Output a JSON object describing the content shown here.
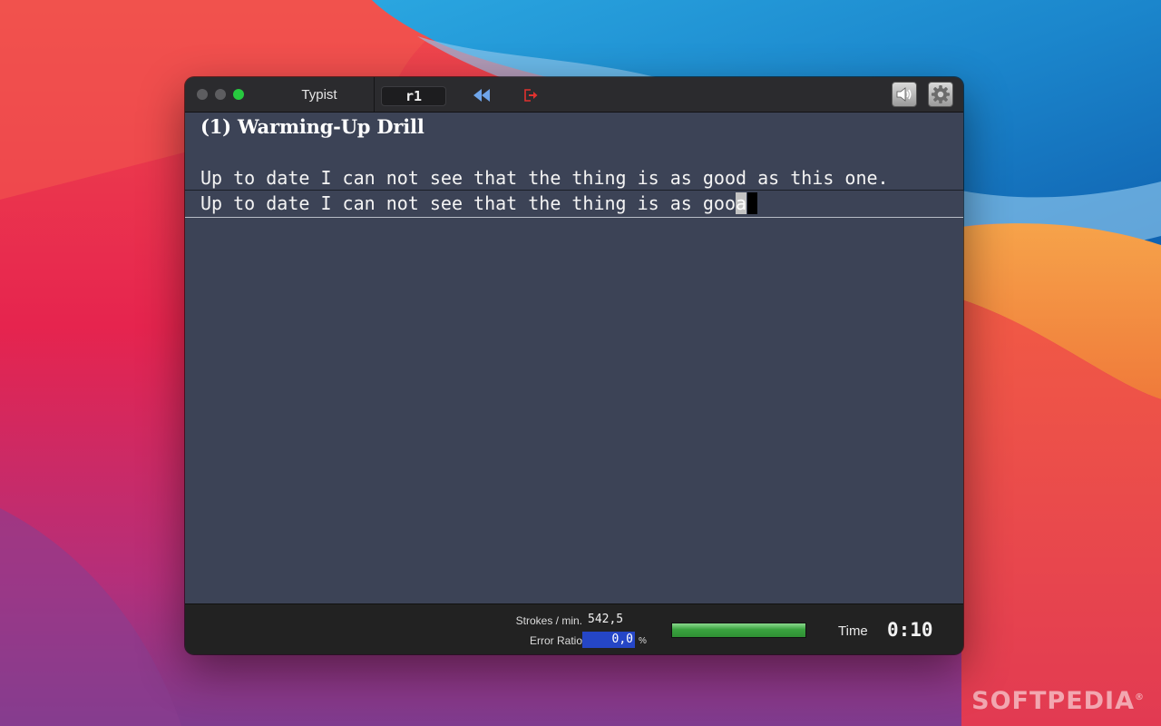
{
  "window": {
    "app_title": "Typist",
    "lesson_code": "r1",
    "icons": {
      "rewind": "rewind-icon",
      "exit": "exit-icon",
      "sound": "speaker-icon",
      "settings": "gear-icon"
    }
  },
  "content": {
    "lesson_title": "(1) Warming-Up Drill",
    "prompt_text": "Up to date I can not see that the thing is as good as this one.",
    "typed_text": "Up to date I can not see that the thing is as goo",
    "typed_error_char": "a"
  },
  "status": {
    "strokes_label": "Strokes / min.",
    "strokes_value": "542,5",
    "error_label": "Error Ratio",
    "error_value": "0,0",
    "error_unit": "%",
    "progress_fraction": 1.0,
    "time_label": "Time",
    "time_value": "0:10"
  },
  "watermark": {
    "text": "SOFTPEDIA",
    "mark": "®"
  },
  "colors": {
    "window_bg": "#3c4356",
    "titlebar_bg": "#2b2b2e",
    "statusbar_bg": "#222222",
    "error_field": "#2546c6",
    "progress_green": "#3aa33f",
    "rewind_blue": "#6fa5ea",
    "exit_red": "#e0322f"
  }
}
